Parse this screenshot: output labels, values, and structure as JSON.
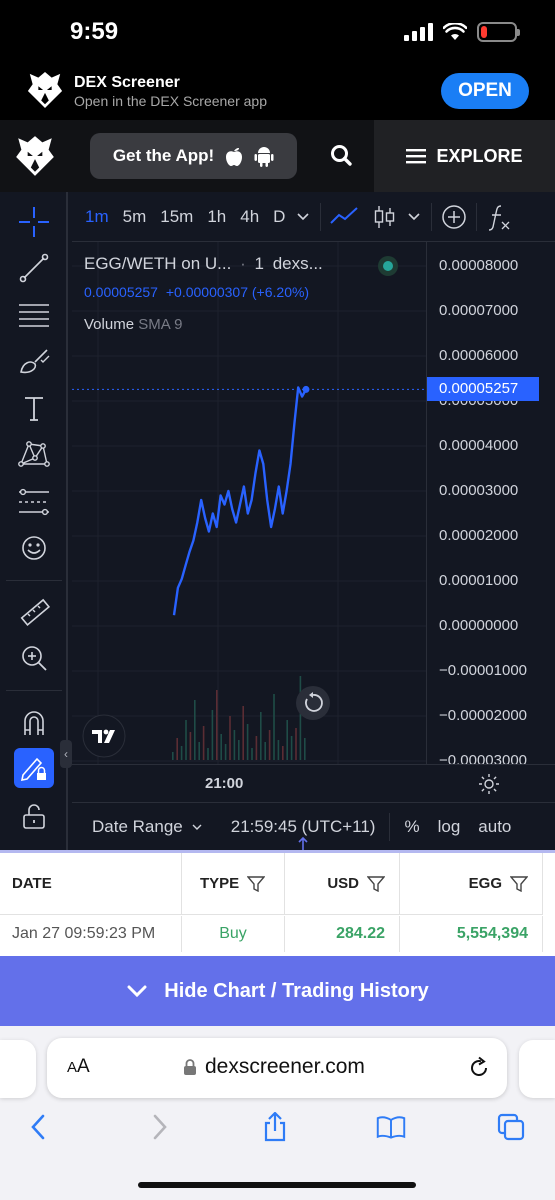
{
  "status_bar": {
    "time": "9:59"
  },
  "app_banner": {
    "title": "DEX Screener",
    "subtitle": "Open in the DEX Screener app",
    "open_label": "OPEN"
  },
  "header": {
    "get_app_label": "Get the App!",
    "explore_label": "EXPLORE"
  },
  "chart": {
    "timeframes": [
      "1m",
      "5m",
      "15m",
      "1h",
      "4h",
      "D"
    ],
    "active_timeframe": "1m",
    "legend_pair": "EGG/WETH on U...",
    "legend_sep": "·",
    "legend_interval": "1",
    "legend_source": "dexs...",
    "legend_price": "0.00005257",
    "legend_change": "+0.00000307 (+6.20%)",
    "volume_label": "Volume",
    "volume_sma": "SMA 9",
    "current_price": "0.00005257",
    "time_label": "21:00",
    "date_range_label": "Date Range",
    "clock": "21:59:45 (UTC+11)",
    "percent_label": "%",
    "log_label": "log",
    "auto_label": "auto",
    "colors": {
      "line": "#2962ff",
      "background": "#131722",
      "up": "#26a69a",
      "down": "#ef5350"
    }
  },
  "chart_data": {
    "type": "line",
    "title": "EGG/WETH",
    "y_ticks": [
      "0.00008000",
      "0.00007000",
      "0.00006000",
      "0.00005000",
      "0.00004000",
      "0.00003000",
      "0.00002000",
      "0.00001000",
      "0.00000000",
      "−0.00001000",
      "−0.00002000",
      "−0.00003000"
    ],
    "ylim": [
      -3e-05,
      8e-05
    ],
    "x_tick": "21:00",
    "series": [
      {
        "values": [
          2.4e-06,
          8.5e-06,
          1.05e-05,
          1.35e-05,
          1.65e-05,
          1.9e-05,
          2.3e-05,
          2.8e-05,
          2.4e-05,
          2.1e-05,
          2.5e-05,
          2.2e-05,
          2.9e-05,
          2.7e-05,
          3e-05,
          2.6e-05,
          2.3e-05,
          2.7e-05,
          3.1e-05,
          2.5e-05,
          2.8e-05,
          3.4e-05,
          3.9e-05,
          3.6e-05,
          2.8e-05,
          2.2e-05,
          2.6e-05,
          3.1e-05,
          2.5e-05,
          3e-05,
          3.6e-05,
          4.5e-05,
          5.3e-05,
          5.1e-05,
          5.257e-05
        ]
      }
    ]
  },
  "trading_history": {
    "columns": [
      "DATE",
      "TYPE",
      "USD",
      "EGG"
    ],
    "rows": [
      {
        "date": "Jan 27 09:59:23 PM",
        "type": "Buy",
        "usd": "284.22",
        "egg": "5,554,394"
      }
    ],
    "hide_label": "Hide Chart / Trading History"
  },
  "browser": {
    "aa_label": "AA",
    "url": "dexscreener.com"
  }
}
